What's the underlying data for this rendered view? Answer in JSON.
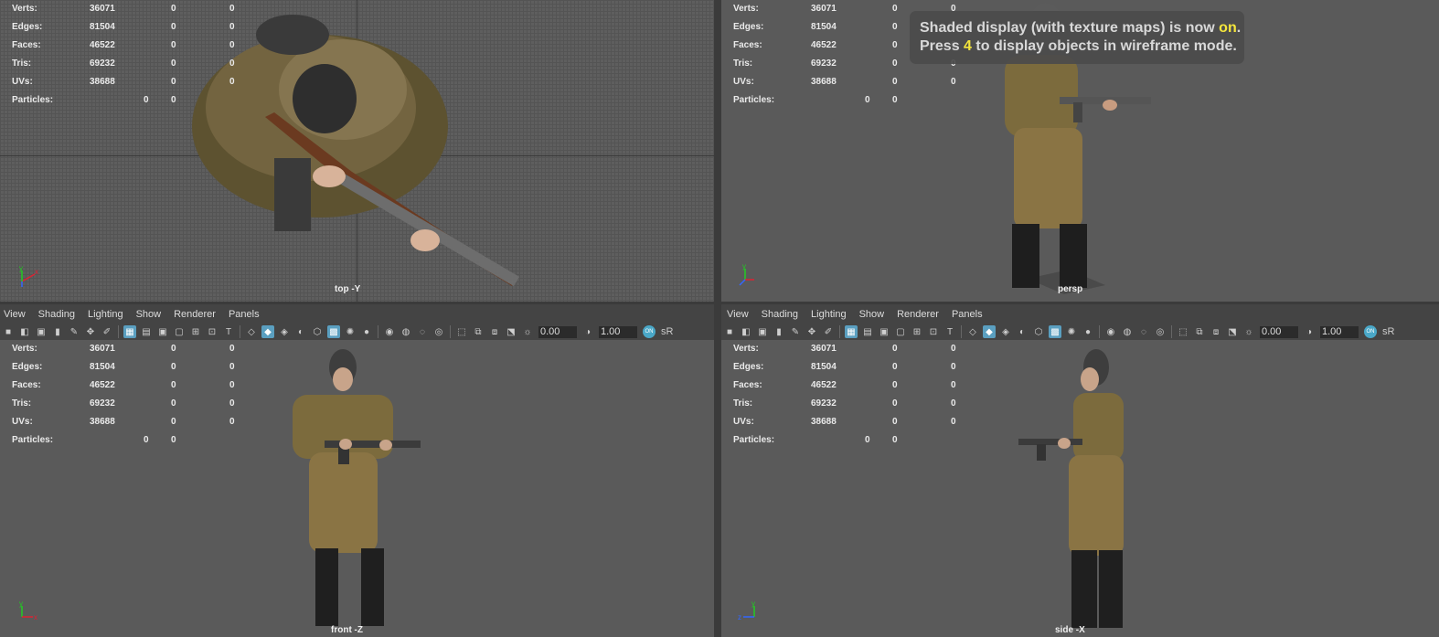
{
  "hud_labels": {
    "verts": "Verts:",
    "edges": "Edges:",
    "faces": "Faces:",
    "tris": "Tris:",
    "uvs": "UVs:",
    "particles": "Particles:"
  },
  "stats": {
    "verts": [
      "36071",
      "0",
      "0"
    ],
    "edges": [
      "81504",
      "0",
      "0"
    ],
    "faces": [
      "46522",
      "0",
      "0"
    ],
    "tris": [
      "69232",
      "0",
      "0"
    ],
    "uvs": [
      "38688",
      "0",
      "0"
    ],
    "particles": [
      "0",
      "0"
    ]
  },
  "cameras": {
    "top": "top -Y",
    "persp": "persp",
    "front": "front -Z",
    "side": "side -X"
  },
  "menu": [
    "View",
    "Shading",
    "Lighting",
    "Show",
    "Renderer",
    "Panels"
  ],
  "toolbar": {
    "field_a": "0.00",
    "field_b": "1.00",
    "toggle": "ON",
    "cut_label": "sR"
  },
  "message": {
    "line1_pre": "Shaded display (with texture maps) is now ",
    "line1_on": "on",
    "line1_post": ".",
    "line2_pre": "Press ",
    "line2_key": "4",
    "line2_post": " to display objects in wireframe mode."
  },
  "axes": {
    "x": "x",
    "y": "y",
    "z": "z"
  },
  "colors": {
    "viewport_bg": "#5a5a5a",
    "highlight": "#f5e63c",
    "active_tool": "#5a9fc0"
  }
}
